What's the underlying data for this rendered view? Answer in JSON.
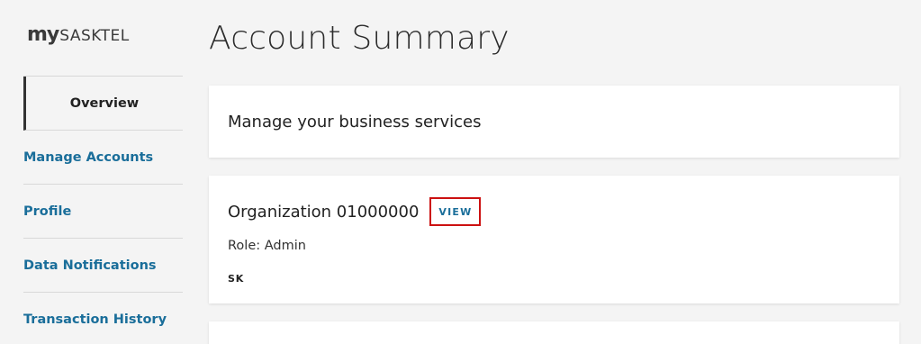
{
  "brand": {
    "my": "my",
    "name": "SASKTEL"
  },
  "sidebar": {
    "items": [
      {
        "label": "Overview",
        "active": true
      },
      {
        "label": "Manage Accounts"
      },
      {
        "label": "Profile"
      },
      {
        "label": "Data Notifications"
      },
      {
        "label": "Transaction History"
      }
    ]
  },
  "main": {
    "title": "Account Summary",
    "manage_card": {
      "title": "Manage your business services"
    },
    "organization_card": {
      "name": "Organization 01000000",
      "view_label": "VIEW",
      "role": "Role: Admin",
      "region": "SK"
    }
  },
  "colors": {
    "background": "#f4f4f4",
    "link": "#1a6e9a",
    "highlight_border": "#cc1111",
    "active_indicator": "#333333"
  }
}
